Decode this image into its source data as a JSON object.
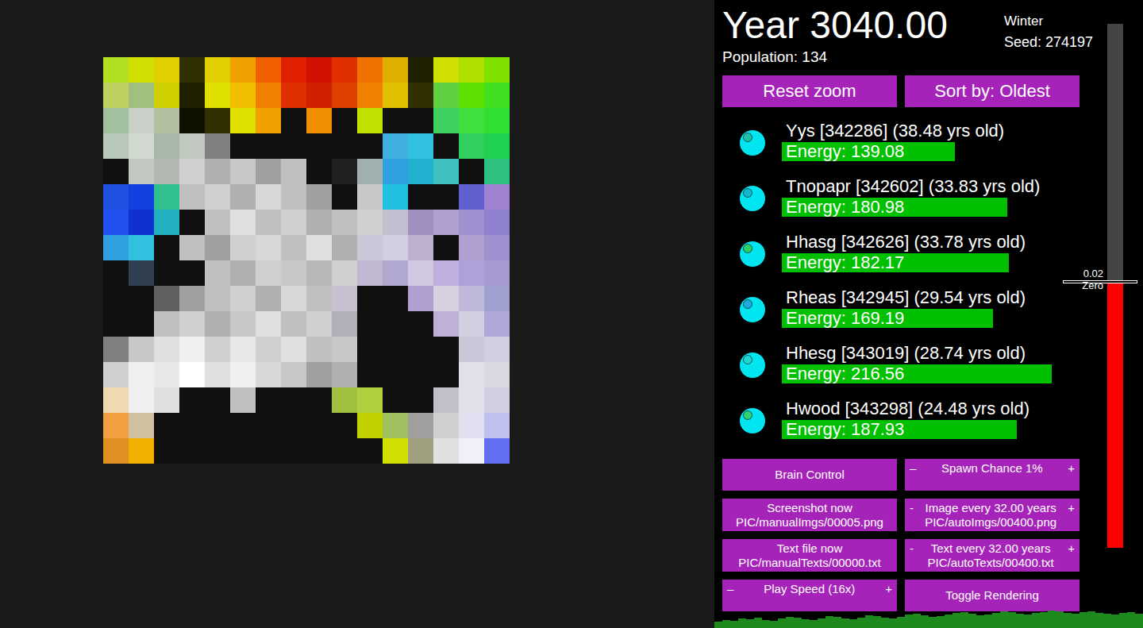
{
  "window": {
    "title": "Year 3040.00",
    "season": "Winter",
    "seed": "Seed: 274197",
    "population": "Population: 134"
  },
  "top_buttons": [
    {
      "label": "Reset zoom"
    },
    {
      "label": "Sort by: Oldest"
    }
  ],
  "creatures": [
    {
      "label": "Yys [342286] (38.48 yrs old)",
      "energy": "Energy: 139.08",
      "level": 0.545,
      "color": "#00e5f0",
      "eye_color": "#20c0a8"
    },
    {
      "label": "Tnopapr [342602] (33.83 yrs old)",
      "energy": "Energy: 180.98",
      "level": 0.71,
      "color": "#00e5f0",
      "eye_color": "#10b8d0"
    },
    {
      "label": "Hhasg [342626] (33.78 yrs old)",
      "energy": "Energy: 182.17",
      "level": 0.715,
      "color": "#00e5f0",
      "eye_color": "#30d060"
    },
    {
      "label": "Rheas [342945] (29.54 yrs old)",
      "energy": "Energy: 169.19",
      "level": 0.665,
      "color": "#00e5f0",
      "eye_color": "#20a8e0"
    },
    {
      "label": "Hhesg [343019] (28.74 yrs old)",
      "energy": "Energy: 216.56",
      "level": 0.85,
      "color": "#00e5f0",
      "eye_color": "#20d8d0"
    },
    {
      "label": "Hwood [343298] (24.48 yrs old)",
      "energy": "Energy: 187.93",
      "level": 0.74,
      "color": "#00e5f0",
      "eye_color": "#30d070"
    }
  ],
  "controls": [
    {
      "kind": "button",
      "label": "Brain Control",
      "sublabel": ""
    },
    {
      "kind": "stepper",
      "minus": "–",
      "label": "Spawn Chance 1%",
      "plus": "+",
      "sublabel": ""
    },
    {
      "kind": "button",
      "label": "Screenshot now",
      "sublabel": "PIC/manualImgs/00005.png"
    },
    {
      "kind": "stepper",
      "minus": "-",
      "label": "Image every 32.00 years",
      "plus": "+",
      "sublabel": "PIC/autoImgs/00400.png"
    },
    {
      "kind": "button",
      "label": "Text file now",
      "sublabel": "PIC/manualTexts/00000.txt"
    },
    {
      "kind": "stepper",
      "minus": "-",
      "label": "Text every 32.00 years",
      "plus": "+",
      "sublabel": "PIC/autoTexts/00400.txt"
    },
    {
      "kind": "stepper",
      "minus": "–",
      "label": "Play Speed (16x)",
      "plus": "+",
      "sublabel": ""
    },
    {
      "kind": "button",
      "label": "Toggle Rendering",
      "sublabel": ""
    }
  ],
  "slider": {
    "level": 0.505,
    "labels": [
      "0.02",
      "Zero"
    ]
  },
  "population_graph": {
    "values": [
      8,
      10,
      9,
      12,
      11,
      13,
      10,
      9,
      12,
      14,
      13,
      11,
      10,
      12,
      15,
      14,
      12,
      11,
      13,
      16,
      15,
      13,
      12,
      14,
      17,
      18,
      16,
      14,
      15,
      17,
      19,
      20,
      18,
      16,
      17,
      19,
      21,
      20,
      18,
      17,
      19,
      20,
      22,
      21,
      19,
      18,
      20,
      21,
      19,
      18,
      17,
      19,
      20,
      18
    ]
  },
  "map": {
    "tiles": [
      [
        "#b0e020",
        "#d0e000",
        "#e0d000",
        "#303000",
        "#e0d000",
        "#f0a000",
        "#f06000",
        "#e02000",
        "#d01000",
        "#e03000",
        "#f07000",
        "#e0b000",
        "#202000",
        "#d0e000",
        "#b0e000",
        "#80e000"
      ],
      [
        "#c0d060",
        "#a0c080",
        "#d0d000",
        "#202000",
        "#e0e000",
        "#f0c000",
        "#f08000",
        "#e03000",
        "#d02000",
        "#e04000",
        "#f08000",
        "#e0c000",
        "#303000",
        "#60d040",
        "#60e000",
        "#40e020"
      ],
      [
        "#a0c0a0",
        "#c8d0c8",
        "#b0c0a0",
        "#101000",
        "#303000",
        "#e0e000",
        "#f0a000",
        "#101010",
        "#f09000",
        "#101010",
        "#c0e000",
        "#101010",
        "#101010",
        "#40d060",
        "#40e040",
        "#30e030"
      ],
      [
        "#b8c8b8",
        "#d0d8d0",
        "#a8b8a8",
        "#c0c8c0",
        "#808080",
        "#101010",
        "#101010",
        "#101010",
        "#101010",
        "#101010",
        "#101010",
        "#40b0e0",
        "#30c0e0",
        "#101010",
        "#30d060",
        "#20d050"
      ],
      [
        "#101010",
        "#c0c8c0",
        "#b0b8b0",
        "#d0d0d0",
        "#b0b0b0",
        "#c8c8c8",
        "#a0a0a0",
        "#c0c0c0",
        "#101010",
        "#202020",
        "#a0b0b0",
        "#30a0e0",
        "#20b0d0",
        "#40c0c0",
        "#101010",
        "#30c080"
      ],
      [
        "#2050e0",
        "#1040e0",
        "#30c090",
        "#c0c0c0",
        "#d0d0d0",
        "#b0b0b0",
        "#d8d8d8",
        "#c0c0c0",
        "#a0a0a0",
        "#101010",
        "#c8c8c8",
        "#20c0e0",
        "#101010",
        "#101010",
        "#6060d0",
        "#a080d0"
      ],
      [
        "#2050f0",
        "#1030d0",
        "#20b0c0",
        "#101010",
        "#c0c0c0",
        "#e0e0e0",
        "#c0c0c0",
        "#d0d0d0",
        "#b0b0b0",
        "#c0c0c0",
        "#d0d0d0",
        "#c0c0d0",
        "#a090c0",
        "#b0a0d0",
        "#a090d0",
        "#9080d0"
      ],
      [
        "#30a0e0",
        "#30c0e0",
        "#101010",
        "#c0c0c0",
        "#a0a0a0",
        "#d0d0d0",
        "#d8d8d8",
        "#c0c0c0",
        "#e0e0e0",
        "#b0b0b0",
        "#c8c8d8",
        "#d0d0e0",
        "#c0b0d0",
        "#101010",
        "#b0a0d0",
        "#a090d0"
      ],
      [
        "#101010",
        "#304050",
        "#101010",
        "#101010",
        "#c0c0c0",
        "#b0b0b0",
        "#d0d0d0",
        "#c8c8c8",
        "#b8b8b8",
        "#d0d0d0",
        "#c0b8d0",
        "#b0a8d0",
        "#d0c8e0",
        "#c0b0e0",
        "#b0a0d8",
        "#a898d0"
      ],
      [
        "#101010",
        "#101010",
        "#606060",
        "#a0a0a0",
        "#c0c0c0",
        "#d0d0d0",
        "#b0b0b0",
        "#d8d8d8",
        "#c0c0c0",
        "#c8c0d0",
        "#101010",
        "#101010",
        "#b0a0d0",
        "#d8d0e0",
        "#c0b8d8",
        "#a0a0d0"
      ],
      [
        "#101010",
        "#101010",
        "#c0c0c0",
        "#d0d0d0",
        "#b0b0b0",
        "#c8c8c8",
        "#e0e0e0",
        "#c0c0c0",
        "#d0d0d0",
        "#b0b0b8",
        "#101010",
        "#101010",
        "#101010",
        "#c0b0d8",
        "#d0d0e0",
        "#b0a8d8"
      ],
      [
        "#808080",
        "#c8c8c8",
        "#e0e0e0",
        "#f0f0f0",
        "#d0d0d0",
        "#e8e8e8",
        "#d0d0d0",
        "#e0e0e0",
        "#c0c0c0",
        "#c8c8c8",
        "#101010",
        "#101010",
        "#101010",
        "#101010",
        "#c8c8d8",
        "#d0d0e0"
      ],
      [
        "#d0d0d0",
        "#f0f0f0",
        "#e8e8e8",
        "#ffffff",
        "#e0e0e0",
        "#f0f0f0",
        "#d8d8d8",
        "#c8c8c8",
        "#a0a0a0",
        "#b0b0b0",
        "#101010",
        "#101010",
        "#101010",
        "#101010",
        "#e0e0e8",
        "#d8d8e0"
      ],
      [
        "#f0d8b0",
        "#f0f0f0",
        "#e0e0e0",
        "#101010",
        "#101010",
        "#c0c0c0",
        "#101010",
        "#101010",
        "#101010",
        "#a0c040",
        "#b0d040",
        "#101010",
        "#101010",
        "#c0c0c8",
        "#e0e0e8",
        "#d0d0e0"
      ],
      [
        "#f0a040",
        "#d0c0a0",
        "#101010",
        "#101010",
        "#101010",
        "#101010",
        "#101010",
        "#101010",
        "#101010",
        "#101010",
        "#c0d000",
        "#a0c060",
        "#a0a0a0",
        "#d0d0d0",
        "#e0e0f0",
        "#c0c0f0"
      ],
      [
        "#e09020",
        "#f0b000",
        "#101010",
        "#101010",
        "#101010",
        "#101010",
        "#101010",
        "#101010",
        "#101010",
        "#101010",
        "#101010",
        "#d0e000",
        "#a0a080",
        "#e0e0e0",
        "#f0f0f8",
        "#6070f0"
      ]
    ]
  }
}
